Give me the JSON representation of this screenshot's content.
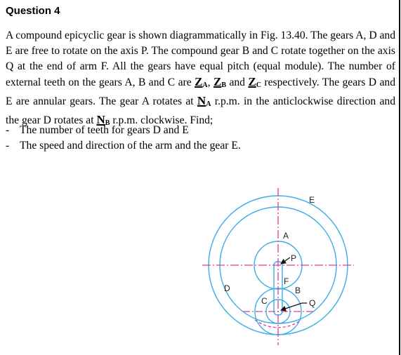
{
  "title": "Question 4",
  "paragraph": {
    "part1": "A compound epicyclic gear is shown diagrammatically in Fig. 13.40. The gears A, D and E are free to rotate on the axis P. The compound gear B and C rotate together on the axis Q at the end of arm F. All the gears have equal pitch (equal module). The number of external teeth on the gears A, B and C are ",
    "za_main": "Z",
    "za_sub": "A",
    "sep1": ", ",
    "zb_main": "Z",
    "zb_sub": "B",
    "sep2": " and ",
    "zc_main": "Z",
    "zc_sub": "C",
    "part2": " respectively. The gears D and E are annular gears. The gear A rotates at ",
    "na_main": "N",
    "na_sub": "A",
    "part3": " r.p.m. in the anticlockwise direction and the gear D rotates at ",
    "nb_main": "N",
    "nb_sub": "B",
    "part4": " r.p.m. clockwise. Find;"
  },
  "bullets": [
    {
      "dash": "-",
      "text": "The number of teeth for gears D and E"
    },
    {
      "dash": "-",
      "text": "The speed and direction of the arm and the gear E."
    }
  ],
  "figure": {
    "labels": {
      "E": "E",
      "A": "A",
      "P": "P",
      "F": "F",
      "D": "D",
      "B": "B",
      "C": "C",
      "Q": "Q"
    },
    "colors": {
      "gear_outline": "#3aaee8",
      "centerline": "#e8399a",
      "arrow": "#111111"
    }
  }
}
